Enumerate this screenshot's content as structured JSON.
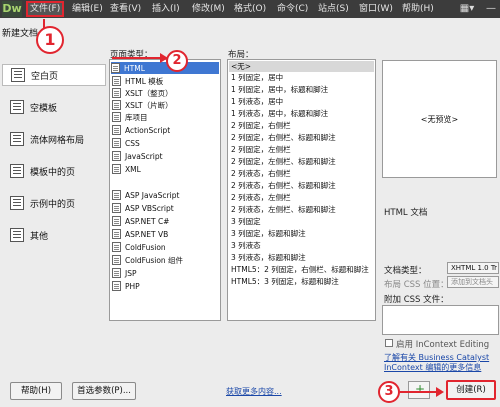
{
  "menubar": {
    "logo": "Dw",
    "items": [
      "文件(F)",
      "编辑(E)",
      "查看(V)",
      "插入(I)",
      "修改(M)",
      "格式(O)",
      "命令(C)",
      "站点(S)",
      "窗口(W)",
      "帮助(H)"
    ],
    "layout_icon": "▦▾",
    "minimize": "—",
    "maximize": "□"
  },
  "dialog": {
    "title": "新建文档"
  },
  "categories": [
    "空白页",
    "空模板",
    "流体网格布局",
    "模板中的页",
    "示例中的页",
    "其他"
  ],
  "page_type": {
    "label": "页面类型：",
    "items": [
      "HTML",
      "HTML 模板",
      "XSLT（整页）",
      "XSLT（片断）",
      "库项目",
      "ActionScript",
      "CSS",
      "JavaScript",
      "XML",
      "ASP JavaScript",
      "ASP VBScript",
      "ASP.NET C#",
      "ASP.NET VB",
      "ColdFusion",
      "ColdFusion 组件",
      "JSP",
      "PHP"
    ]
  },
  "layout": {
    "label": "布局：",
    "items": [
      "<无>",
      "1 列固定，居中",
      "1 列固定，居中，标题和脚注",
      "1 列液态，居中",
      "1 列液态，居中，标题和脚注",
      "2 列固定，右侧栏",
      "2 列固定，右侧栏、标题和脚注",
      "2 列固定，左侧栏",
      "2 列固定，左侧栏、标题和脚注",
      "2 列液态，右侧栏",
      "2 列液态，右侧栏、标题和脚注",
      "2 列液态，左侧栏",
      "2 列液态，左侧栏、标题和脚注",
      "3 列固定",
      "3 列固定，标题和脚注",
      "3 列液态",
      "3 列液态，标题和脚注",
      "HTML5：2 列固定，右侧栏、标题和脚注",
      "HTML5：3 列固定，标题和脚注"
    ]
  },
  "preview": {
    "placeholder": "<无预览>",
    "description": "HTML 文档"
  },
  "doctype": {
    "label": "文档类型：",
    "value": "XHTML 1.0 Tr"
  },
  "css_position": {
    "label": "布局 CSS 位置：",
    "value": "添加到文档头"
  },
  "attach_css": {
    "label": "附加 CSS 文件："
  },
  "incontext": {
    "label": "启用 InContext Editing"
  },
  "learn_more": {
    "line1": "了解有关 Business Catalyst",
    "line2": "InContext 编辑的更多信息"
  },
  "footer": {
    "help": "帮助(H)",
    "prefs": "首选参数(P)...",
    "get_more": "获取更多内容...",
    "create": "创建(R)"
  },
  "annotations": {
    "step1": "1",
    "step2": "2",
    "step3": "3"
  }
}
